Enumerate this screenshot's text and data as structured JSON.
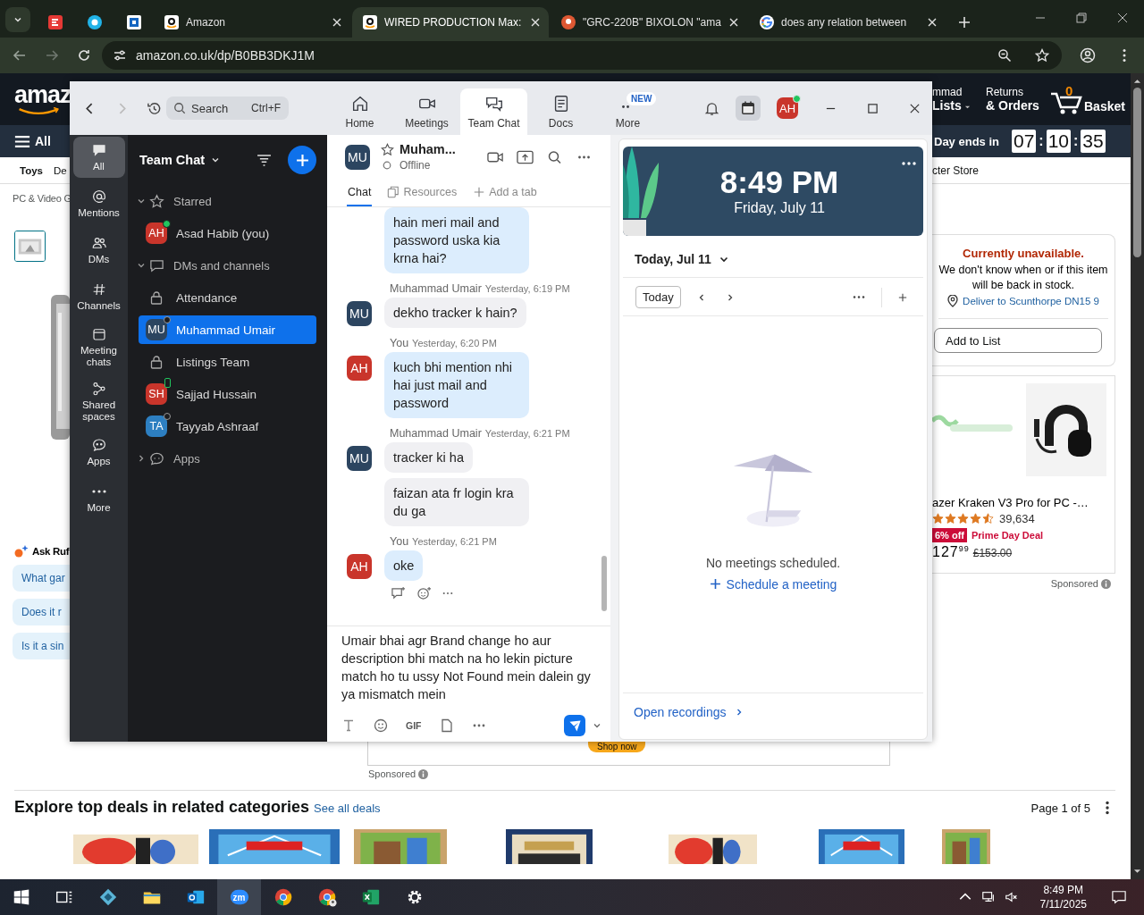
{
  "browser": {
    "tabs": [
      {
        "selected": false
      },
      {
        "selected": false
      },
      {
        "selected": false
      },
      {
        "title": "Amazon",
        "selected": false
      },
      {
        "title": "WIRED PRODUCTION Max:",
        "selected": true
      },
      {
        "title": "\"GRC-220B\" BIXOLON \"ama",
        "selected": false
      },
      {
        "title": "does any relation between",
        "selected": false
      }
    ],
    "address": "amazon.co.uk/dp/B0BB3DKJ1M"
  },
  "amazon": {
    "logo": "amaz",
    "account": {
      "line1": "mmad",
      "line2": "Lists"
    },
    "returns": {
      "line1": "Returns",
      "line2": "& Orders"
    },
    "basket": {
      "count": "0",
      "label": "Basket"
    },
    "menu_label": "All",
    "deal": {
      "label": "Day ends in",
      "timer": [
        {
          "kind": "digits",
          "text": "07"
        },
        {
          "kind": "sep",
          "text": ":"
        },
        {
          "kind": "digits",
          "text": "10"
        },
        {
          "kind": "sep",
          "text": ":"
        },
        {
          "kind": "digits",
          "text": "35"
        }
      ]
    },
    "subnav_left": [
      "Toys",
      "De"
    ],
    "subnav_right": "cter Store",
    "breadcrumb": "PC & Video G",
    "ask": {
      "title": "Ask Ruf",
      "questions": [
        "What gar",
        "Does it r",
        "Is it a sin"
      ]
    },
    "availability": {
      "status": "Currently unavailable.",
      "note": "We don't know when or if this item will be back in stock.",
      "deliver": "Deliver to Scunthorpe DN15 9",
      "button": "Add to List"
    },
    "ad": {
      "title": "azer Kraken V3 Pro for PC -…",
      "stars": 4.5,
      "reviews": "39,634",
      "discount": "6% off",
      "deal": "Prime Day Deal",
      "price_whole": "127",
      "price_fraction": "99",
      "list_price": "£153.00",
      "sponsored": "Sponsored"
    },
    "banner": {
      "button": "Shop now",
      "sponsored": "Sponsored"
    },
    "deals": {
      "title": "Explore top deals in related categories",
      "link": "See all deals",
      "page": "Page 1 of 5"
    }
  },
  "zoom": {
    "search": {
      "placeholder": "Search",
      "shortcut": "Ctrl+F"
    },
    "nav": [
      {
        "label": "Home",
        "selected": false
      },
      {
        "label": "Meetings",
        "selected": false
      },
      {
        "label": "Team Chat",
        "selected": true
      },
      {
        "label": "Docs",
        "selected": false
      },
      {
        "label": "More",
        "badge": "NEW",
        "selected": false
      }
    ],
    "user": {
      "initials": "AH",
      "color": "#c9352b",
      "online": true
    },
    "rail": [
      {
        "label": "All",
        "selected": true
      },
      {
        "label": "Mentions",
        "selected": false
      },
      {
        "label": "DMs",
        "selected": false
      },
      {
        "label": "Channels",
        "selected": false
      },
      {
        "label": "Meeting chats",
        "selected": false
      },
      {
        "label": "Shared spaces",
        "selected": false
      },
      {
        "label": "Apps",
        "selected": false
      },
      {
        "label": "More",
        "selected": false
      }
    ],
    "list": {
      "title": "Team Chat",
      "sections": [
        {
          "label": "Starred",
          "expanded": true,
          "children": [
            {
              "kind": "person",
              "name": "Asad Habib (you)",
              "initials": "AH",
              "color": "#c9352b",
              "online": true,
              "mobile": false,
              "selected": false
            }
          ]
        },
        {
          "label": "DMs and channels",
          "expanded": true,
          "children": [
            {
              "kind": "channel",
              "name": "Attendance",
              "selected": false
            },
            {
              "kind": "person",
              "name": "Muhammad Umair",
              "initials": "MU",
              "color": "#2c4560",
              "online": false,
              "mobile": false,
              "selected": true
            },
            {
              "kind": "channel",
              "name": "Listings Team",
              "selected": false
            },
            {
              "kind": "person",
              "name": "Sajjad Hussain",
              "initials": "SH",
              "color": "#c9352b",
              "online": true,
              "mobile": true,
              "selected": false
            },
            {
              "kind": "person",
              "name": "Tayyab Ashraaf",
              "initials": "TA",
              "color": "#2d7fc1",
              "online": false,
              "mobile": false,
              "selected": false
            }
          ]
        },
        {
          "label": "Apps",
          "expanded": false
        }
      ]
    },
    "chat": {
      "name": "Muham...",
      "initials": "MU",
      "color": "#2c4560",
      "status": "Offline",
      "tabs": [
        {
          "label": "Chat",
          "selected": true
        },
        {
          "label": "Resources",
          "selected": false
        },
        {
          "label": "Add a tab",
          "selected": false
        }
      ],
      "messages": [
        {
          "kind": "self",
          "texts": [
            "hain meri mail and password uska kia krna hai?"
          ]
        },
        {
          "kind": "other",
          "initials": "MU",
          "color": "#2c4560",
          "sender": "Muhammad Umair",
          "time": "Yesterday, 6:19 PM",
          "texts": [
            "dekho tracker k hain?"
          ]
        },
        {
          "kind": "self",
          "initials": "AH",
          "color": "#c9352b",
          "sender": "You",
          "time": "Yesterday, 6:20 PM",
          "texts": [
            "kuch bhi mention nhi hai just mail and password"
          ]
        },
        {
          "kind": "other",
          "initials": "MU",
          "color": "#2c4560",
          "sender": "Muhammad Umair",
          "time": "Yesterday, 6:21 PM",
          "texts": [
            "tracker ki ha",
            "faizan ata fr login kra du ga"
          ]
        },
        {
          "kind": "self",
          "initials": "AH",
          "color": "#c9352b",
          "sender": "You",
          "time": "Yesterday, 6:21 PM",
          "texts": [
            "oke"
          ]
        }
      ],
      "draft": "Umair bhai agr Brand change ho aur description bhi match na ho lekin picture match ho tu ussy Not Found mein dalein gy ya mismatch mein",
      "gif": "GIF"
    },
    "calendar": {
      "time": "8:49 PM",
      "date": "Friday, July 11",
      "day": "Today, Jul 11",
      "today_button": "Today",
      "empty": "No meetings scheduled.",
      "schedule": "Schedule a meeting",
      "recordings": "Open recordings"
    }
  },
  "taskbar": {
    "apps": [
      {
        "active": false
      },
      {
        "active": false
      },
      {
        "active": false
      },
      {
        "label": "zm",
        "active": true
      },
      {
        "active": false
      },
      {
        "active": false
      },
      {
        "active": false
      },
      {
        "active": false
      }
    ],
    "time": "8:49 PM",
    "date": "7/11/2025"
  }
}
